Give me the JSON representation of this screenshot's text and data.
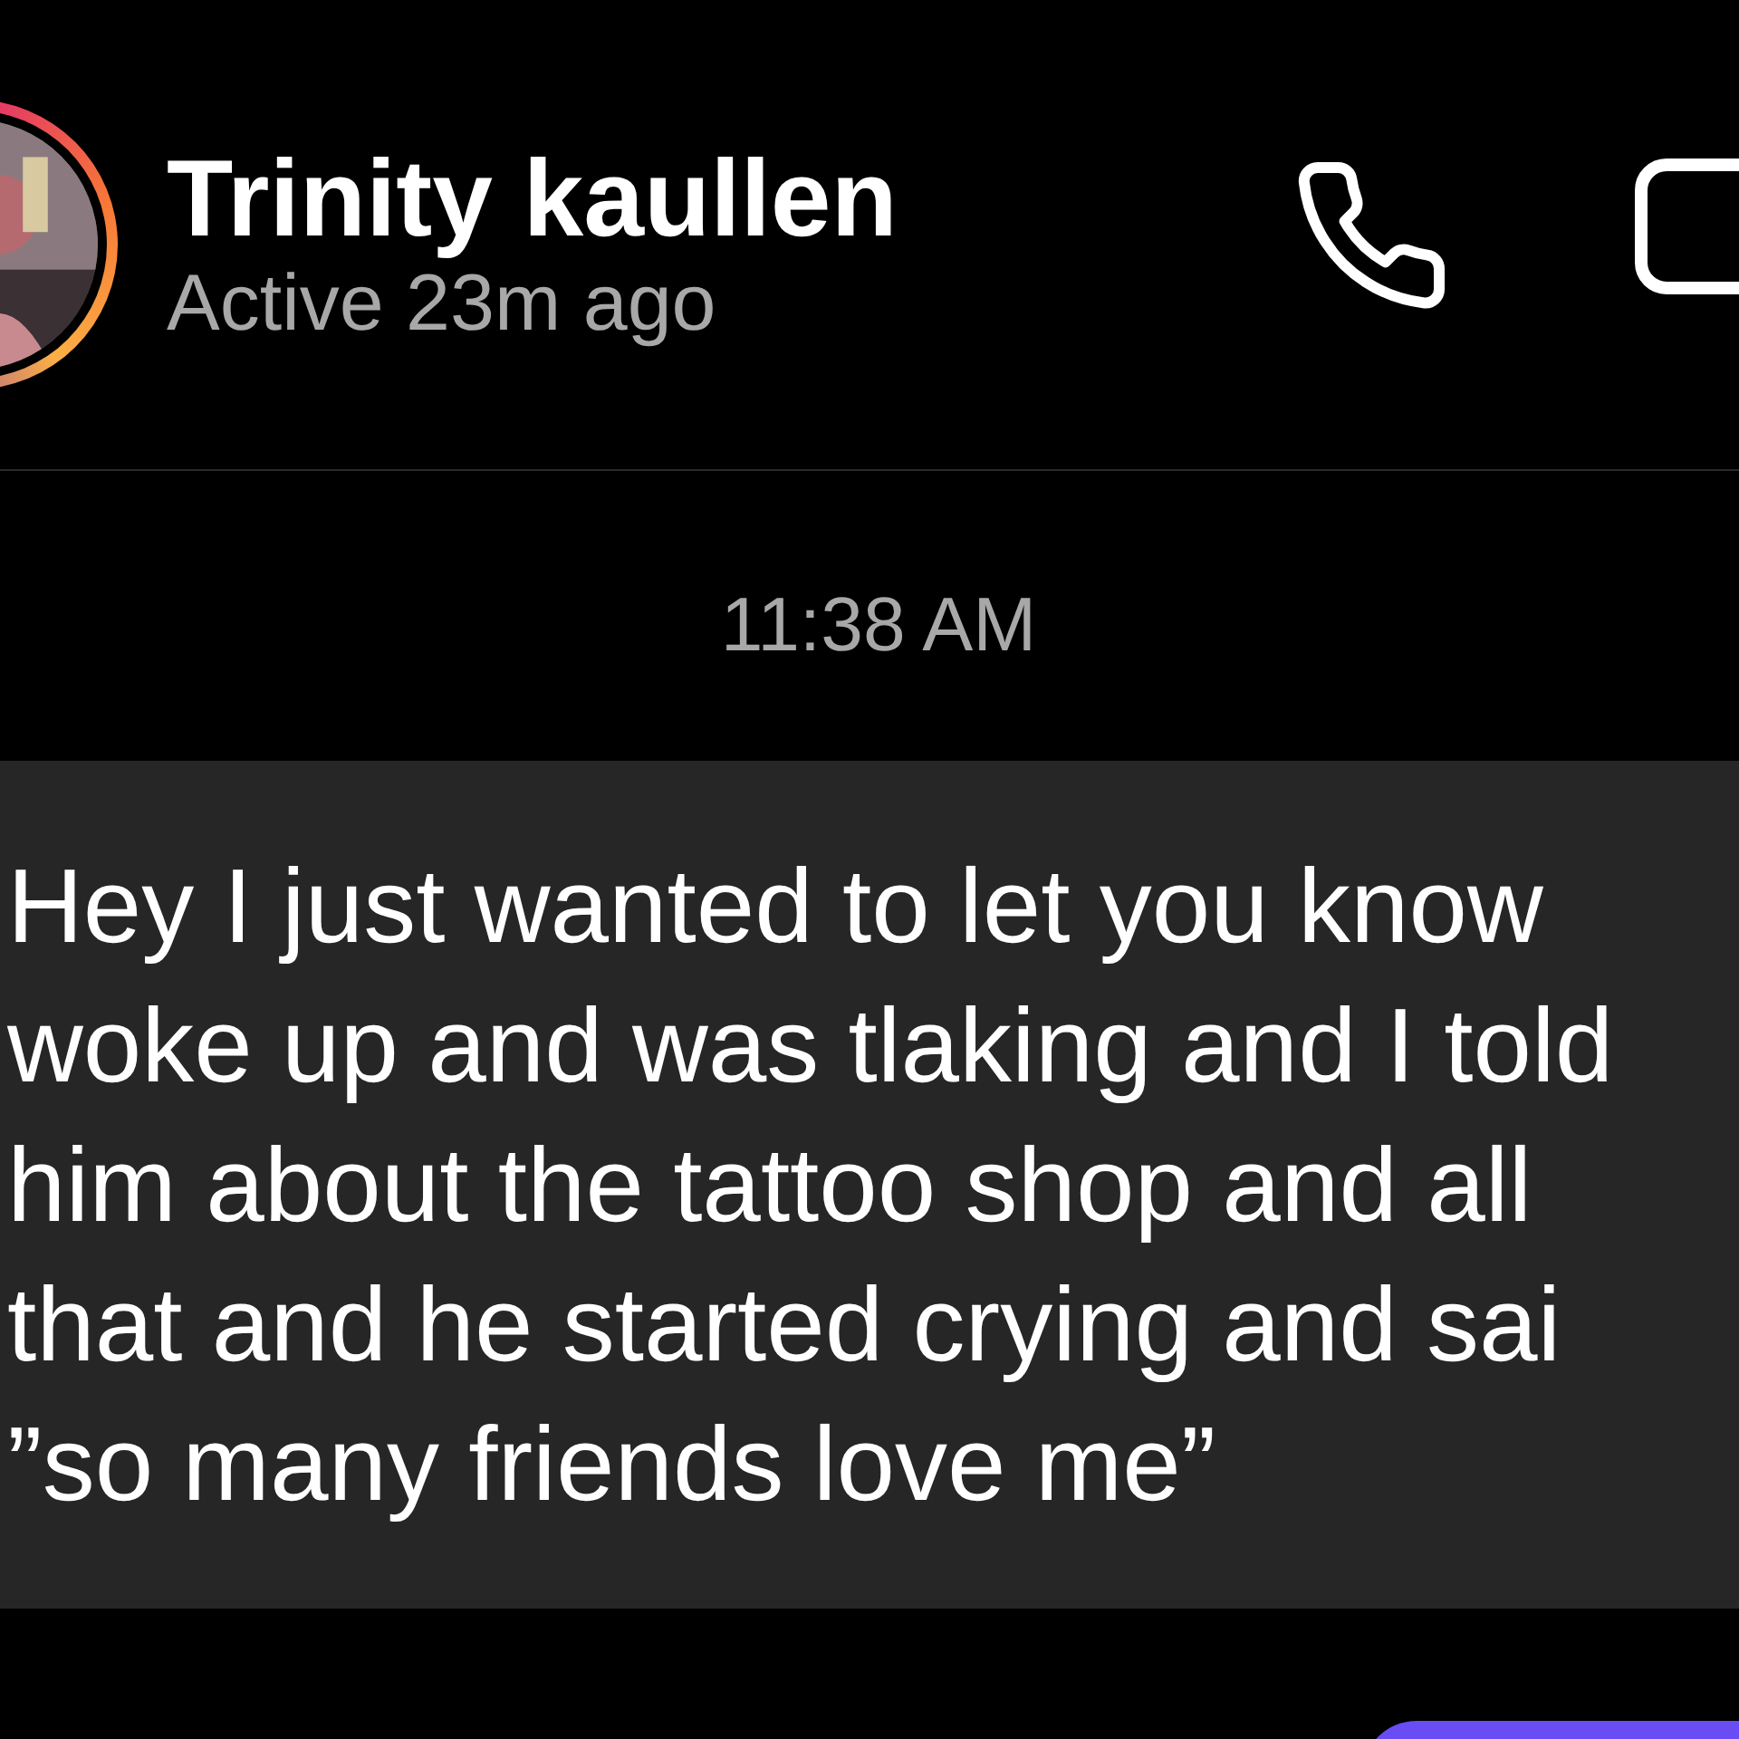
{
  "contact": {
    "name": "Trinity kaullen",
    "status": "Active 23m ago"
  },
  "timestamp": "11:38 AM",
  "messages": [
    {
      "kind": "received",
      "lines": [
        "Hey I just wanted to let you know",
        "woke up and was tlaking and I told",
        "him about the tattoo shop and all",
        "that and he started crying and sai",
        "”so many friends love me”"
      ]
    },
    {
      "kind": "sent"
    }
  ]
}
